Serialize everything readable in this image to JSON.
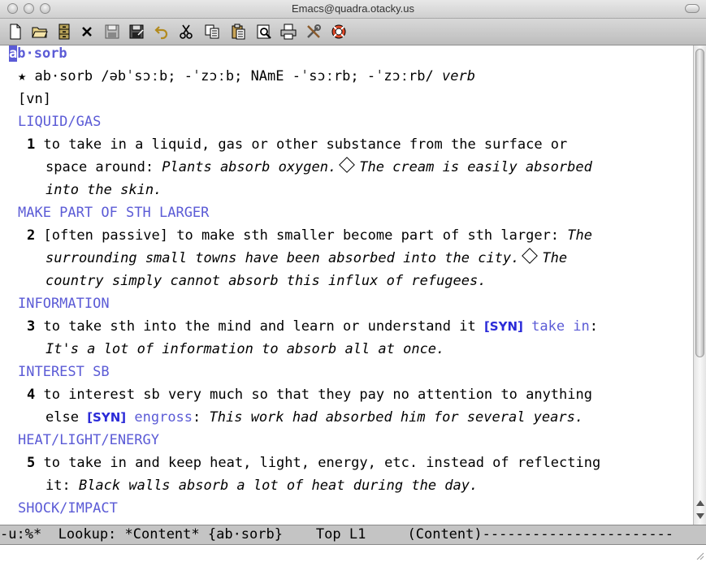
{
  "window": {
    "title": "Emacs@quadra.otacky.us"
  },
  "toolbar": {
    "buttons": [
      {
        "icon": "new-file-icon"
      },
      {
        "icon": "open-folder-icon"
      },
      {
        "icon": "dired-cabinet-icon"
      },
      {
        "icon": "close-buffer-icon"
      },
      {
        "icon": "save-icon"
      },
      {
        "icon": "save-as-icon"
      },
      {
        "icon": "undo-icon"
      },
      {
        "icon": "cut-icon"
      },
      {
        "icon": "copy-icon"
      },
      {
        "icon": "paste-icon"
      },
      {
        "icon": "search-icon"
      },
      {
        "icon": "print-icon"
      },
      {
        "icon": "preferences-icon"
      },
      {
        "icon": "help-icon"
      }
    ]
  },
  "entry": {
    "headword": "ab·sorb",
    "headword_cursor_char": "a",
    "headword_rest": "b·sorb",
    "pron_line": "★ ab·sorb /əbˈsɔːb; -ˈzɔːb; NAmE -ˈsɔːrb; -ˈzɔːrb/ ",
    "pos": "verb",
    "grammar": "[vn]",
    "sections": [
      {
        "label": "LIQUID/GAS"
      },
      {
        "label": "MAKE PART OF STH LARGER"
      },
      {
        "label": "INFORMATION"
      },
      {
        "label": "INTEREST SB"
      },
      {
        "label": "HEAT/LIGHT/ENERGY"
      },
      {
        "label": "SHOCK/IMPACT"
      }
    ],
    "sense1": {
      "num": "1",
      "l1": " to take in a liquid, gas or other substance from the surface or",
      "l2a": "space around: ",
      "ex1": "Plants absorb oxygen.",
      "ex2": "The cream is easily absorbed",
      "l3": "into the skin."
    },
    "sense2": {
      "num": "2",
      "l1a": " [often passive] to make sth smaller become part of sth larger: ",
      "l1ex": "The",
      "l2": "surrounding small towns have been absorbed into the city.",
      "l2ex": "The",
      "l3": "country simply cannot absorb this influx of refugees."
    },
    "sense3": {
      "num": "3",
      "l1a": " to take sth into the mind and learn or understand it ",
      "syn": "[SYN]",
      "syn_word": "take in",
      "colon": ":",
      "l2": "It's a lot of information to absorb all at once."
    },
    "sense4": {
      "num": "4",
      "l1": " to interest sb very much so that they pay no attention to anything",
      "l2a": "else ",
      "syn": "[SYN]",
      "syn_word": "engross",
      "l2b": ": ",
      "l2ex": "This work had absorbed him for several years."
    },
    "sense5": {
      "num": "5",
      "l1": " to take in and keep heat, light, energy, etc. instead of reflecting",
      "l2a": "it: ",
      "l2ex": "Black walls absorb a lot of heat during the day."
    }
  },
  "modeline": {
    "text": "-u:%*  Lookup: *Content* {ab·sorb}    Top L1     (Content)-----------------------"
  }
}
